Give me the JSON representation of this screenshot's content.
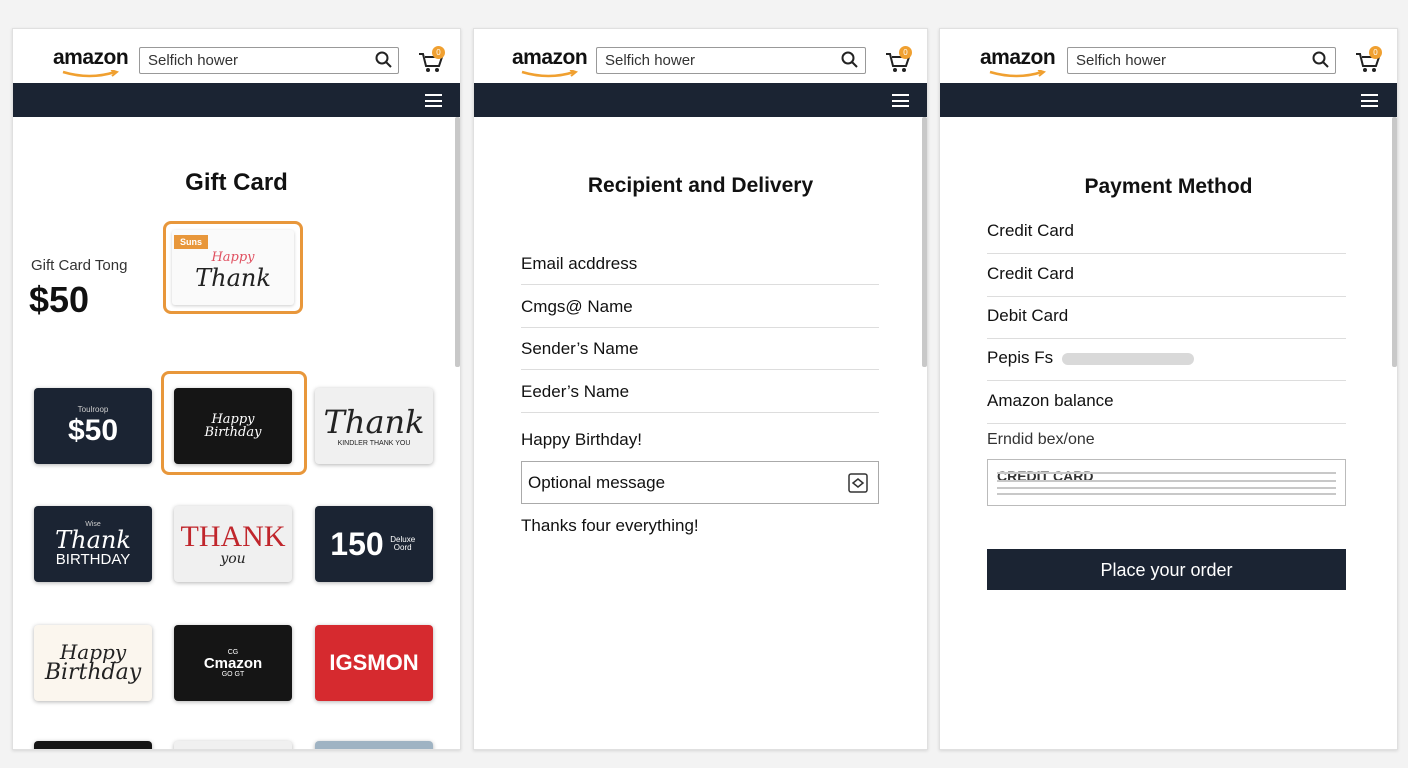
{
  "header": {
    "logo": "amazon",
    "search_value": "Selfich hower",
    "cart_count": "0"
  },
  "panel1": {
    "title": "Gift Card",
    "gift_card_label": "Gift Card Tong",
    "amount": "$50",
    "featured": {
      "badge": "Suns",
      "line1": "Happy",
      "line2": "Thank"
    },
    "cards": [
      {
        "top": "Toulroop",
        "main": "$50"
      },
      {
        "top": "Happy",
        "main": "Birthday"
      },
      {
        "top": "Thank",
        "main": "KINDLER THANK YOU"
      },
      {
        "top": "Wise",
        "main": "Thank",
        "bottom": "BIRTHDAY"
      },
      {
        "top": "THANK",
        "main": "you"
      },
      {
        "top": "150",
        "main": "Deluxe Oord"
      },
      {
        "top": "Happy",
        "main": "Birthday"
      },
      {
        "top": "CG",
        "main": "Cmazon",
        "bottom": "GO GT"
      },
      {
        "top": "IGSMON",
        "main": ""
      }
    ]
  },
  "panel2": {
    "title": "Recipient and Delivery",
    "fields": [
      "Email acddress",
      "Cmgs@ Name",
      "Sender’s Name",
      "Eeder’s Name"
    ],
    "greeting": "Happy Birthday!",
    "message_placeholder": "Optional message",
    "closing": "Thanks four everything!"
  },
  "panel3": {
    "title": "Payment Method",
    "options": [
      "Credit Card",
      "Credit Card",
      "Debit Card",
      "Pepis Fs",
      "Amazon balance"
    ],
    "card_field_label": "Erndid bex/one",
    "card_field_value": "CREDIT CARD",
    "place_order_label": "Place your order"
  },
  "colors": {
    "navbar": "#1b2433",
    "accent": "#e8973b",
    "button": "#1b2433"
  }
}
